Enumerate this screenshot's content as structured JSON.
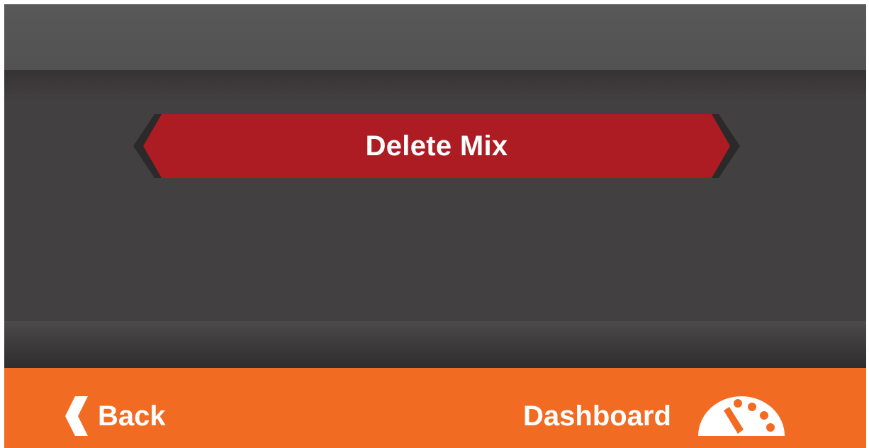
{
  "actions": {
    "delete_label": "Delete Mix"
  },
  "footer": {
    "back_label": "Back",
    "dashboard_label": "Dashboard"
  },
  "icons": {
    "back": "chevron-left-icon",
    "dashboard": "gauge-icon"
  },
  "colors": {
    "footer": "#f26b22",
    "delete_button": "#ad1c23",
    "background": "#434041",
    "header": "#555555"
  }
}
